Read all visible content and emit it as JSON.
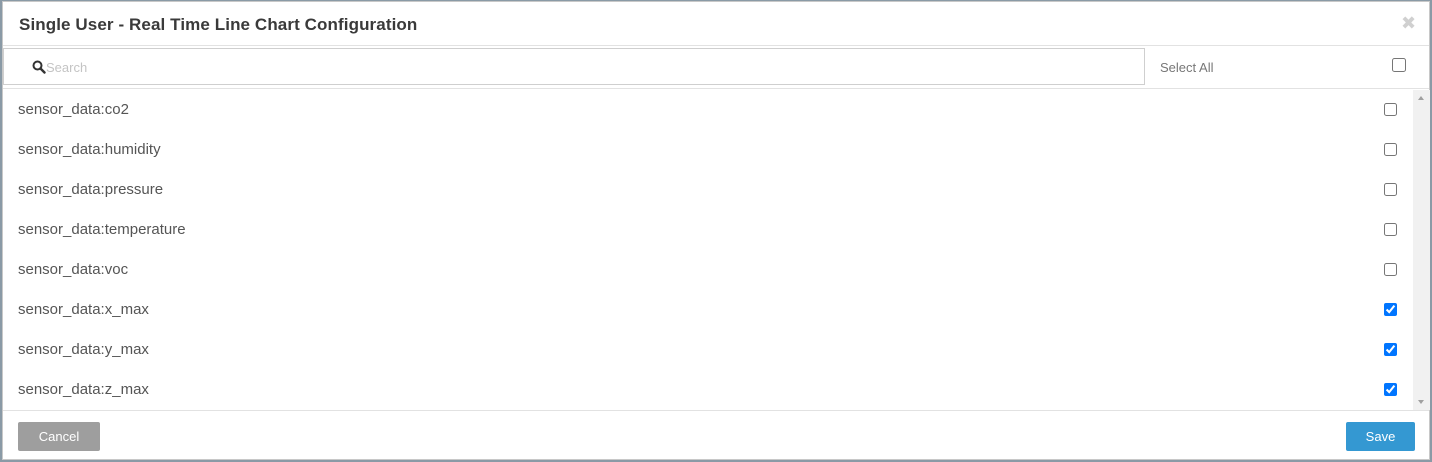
{
  "modal": {
    "title": "Single User - Real Time Line Chart Configuration",
    "close_icon": "close-icon"
  },
  "search": {
    "placeholder": "Search",
    "value": "",
    "icon": "search-icon"
  },
  "select_all": {
    "label": "Select All",
    "checked": false
  },
  "items": [
    {
      "label": "sensor_data:co2",
      "checked": false
    },
    {
      "label": "sensor_data:humidity",
      "checked": false
    },
    {
      "label": "sensor_data:pressure",
      "checked": false
    },
    {
      "label": "sensor_data:temperature",
      "checked": false
    },
    {
      "label": "sensor_data:voc",
      "checked": false
    },
    {
      "label": "sensor_data:x_max",
      "checked": true
    },
    {
      "label": "sensor_data:y_max",
      "checked": true
    },
    {
      "label": "sensor_data:z_max",
      "checked": true
    }
  ],
  "footer": {
    "cancel_label": "Cancel",
    "save_label": "Save"
  },
  "colors": {
    "save_button": "#3498d2",
    "cancel_button": "#9e9e9e",
    "backdrop": "#8a9aa6"
  }
}
